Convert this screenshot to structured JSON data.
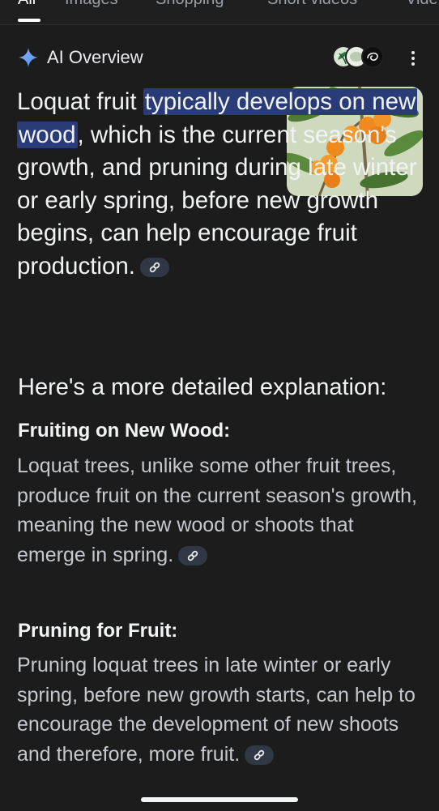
{
  "tabs": [
    {
      "label": "All",
      "active": true
    },
    {
      "label": "Images"
    },
    {
      "label": "Shopping"
    },
    {
      "label": "Short videos"
    },
    {
      "label": "Vide"
    }
  ],
  "overview": {
    "title": "AI Overview",
    "icons": [
      "sparkle-icon",
      "source-avatars",
      "more-vert-icon"
    ]
  },
  "lead": {
    "prefix": "Loquat fruit ",
    "highlight": "typically develops on new wood",
    "suffix": ", which is the current season's growth, and pruning during late winter or early spring, before new growth begins, can help encourage fruit production."
  },
  "explanation_heading": "Here's a more detailed explanation:",
  "sections": [
    {
      "heading": "Fruiting on New Wood:",
      "body": "Loquat trees, unlike some other fruit trees, produce fruit on the current season's growth, meaning the new wood or shoots that emerge in spring."
    },
    {
      "heading": "Pruning for Fruit:",
      "body": "Pruning loquat trees in late winter or early spring, before new growth starts, can help to encourage the development of new shoots and therefore, more fruit."
    }
  ],
  "colors": {
    "background": "#1f1f1f",
    "highlight": "#2a3c78",
    "link_chip": "#303845",
    "sparkle": "#7ab0ff"
  }
}
